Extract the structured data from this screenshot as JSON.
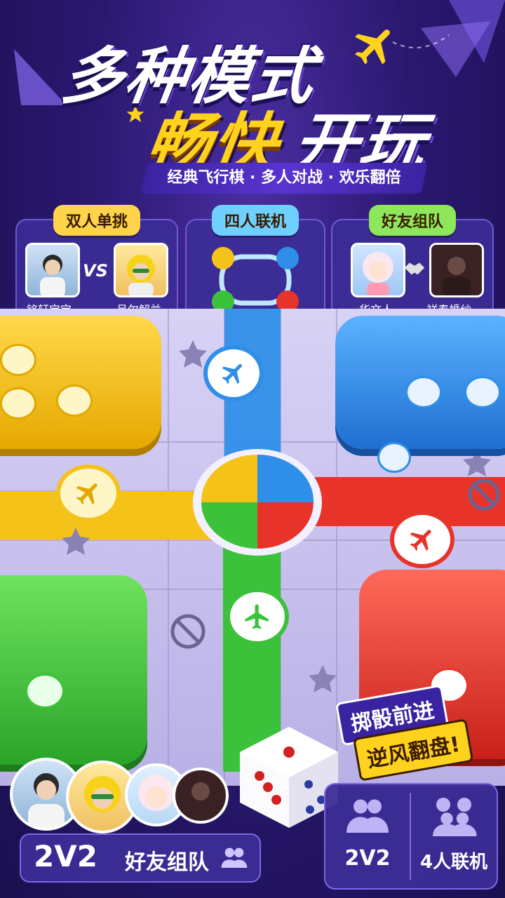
{
  "headline": {
    "line1": "多种模式",
    "line2_highlight": "畅快",
    "line2_rest": "开玩"
  },
  "subtitle": "经典飞行棋 · 多人对战 · 欢乐翻倍",
  "modes": [
    {
      "tag": "双人单挑",
      "tag_color": "#ffd44a",
      "player_left": "铭轩宝宝",
      "vs": "VS",
      "player_right": "吕尔解兰"
    },
    {
      "tag": "四人联机",
      "tag_color": "#6fd0ff"
    },
    {
      "tag": "好友组队",
      "tag_color": "#8ee65a",
      "player_left": "华文人",
      "player_right": "祥春婚纱..."
    }
  ],
  "slogan": {
    "line1": "掷骰前进",
    "line2": "逆风翻盘!"
  },
  "team_bar": {
    "label_bold": "2V2",
    "label": "好友组队"
  },
  "mode_buttons": [
    {
      "label": "2V2"
    },
    {
      "label": "4人联机"
    }
  ],
  "colors": {
    "yellow": "#f5c21a",
    "blue": "#2f8fe8",
    "red": "#e8332a",
    "green": "#3cc23a",
    "bg": "#2a1870"
  },
  "icons": [
    "plane-icon",
    "star-icon",
    "forbidden-icon",
    "handshake-icon",
    "group-icon",
    "dice-icon"
  ]
}
